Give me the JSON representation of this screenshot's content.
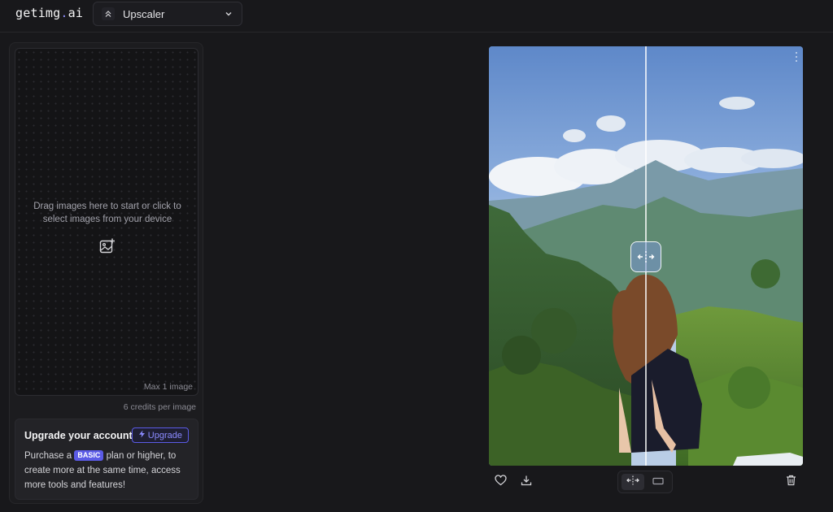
{
  "header": {
    "logo_main": "getimg",
    "logo_dot": ".",
    "logo_suffix": "ai",
    "tool_select_value": "Upscaler"
  },
  "left_panel": {
    "dropzone_text": "Drag images here to start or click to select images from your device",
    "max_images": "Max 1 image",
    "credits": "6 credits per image",
    "upgrade": {
      "title": "Upgrade your account",
      "button_label": "Upgrade",
      "desc_before": "Purchase a",
      "plan_badge": "BASIC",
      "desc_after": "plan or higher, to create more at the same time, access more tools and features!"
    }
  },
  "preview": {
    "icons": [
      "split-compare-icon",
      "heart-icon",
      "download-icon",
      "compare-view-icon",
      "single-view-icon",
      "trash-icon"
    ]
  },
  "colors": {
    "background": "#18181b",
    "panel": "#1c1c1f",
    "accent": "#5b5be6",
    "accent_text": "#8b8bff"
  }
}
